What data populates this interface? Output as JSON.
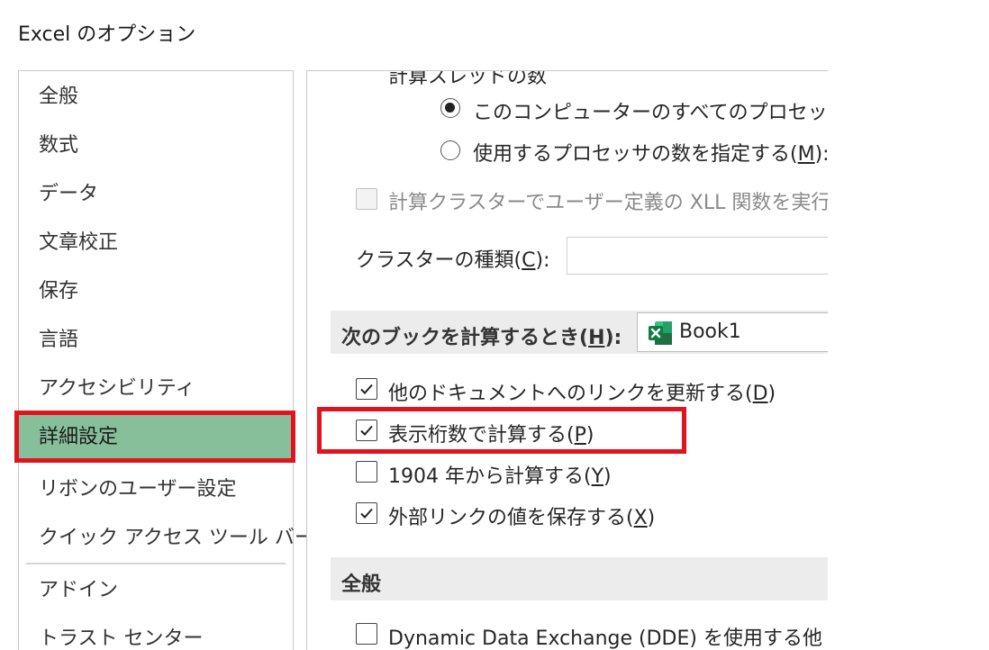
{
  "window": {
    "title": "Excel のオプション"
  },
  "sidebar": {
    "items": [
      {
        "label": "全般"
      },
      {
        "label": "数式"
      },
      {
        "label": "データ"
      },
      {
        "label": "文章校正"
      },
      {
        "label": "保存"
      },
      {
        "label": "言語"
      },
      {
        "label": "アクセシビリティ"
      },
      {
        "label": "詳細設定",
        "selected": true
      },
      {
        "label": "リボンのユーザー設定"
      },
      {
        "label": "クイック アクセス ツール バー"
      },
      {
        "label": "アドイン"
      },
      {
        "label": "トラスト センター"
      }
    ]
  },
  "formula": {
    "threads_heading_partial": "計算スレッドの数",
    "radio_all_processors": {
      "label": "このコンピューターのすべてのプロセッサを使",
      "selected": true
    },
    "radio_specify": {
      "prefix": "使用するプロセッサの数を指定する(",
      "key": "M",
      "suffix": "):",
      "selected": false
    },
    "cluster_checkbox": {
      "label": "計算クラスターでユーザー定義の XLL 関数を実行で",
      "checked": false,
      "disabled": true
    },
    "cluster_type": {
      "prefix": "クラスターの種類(",
      "key": "C",
      "suffix": "):",
      "value": ""
    }
  },
  "workbook_calc": {
    "label_prefix": "次のブックを計算するとき(",
    "label_key": "H",
    "label_suffix": "):",
    "selected_book": "Book1",
    "options": [
      {
        "prefix": "他のドキュメントへのリンクを更新する(",
        "key": "D",
        "suffix": ")",
        "checked": true
      },
      {
        "prefix": "表示桁数で計算する(",
        "key": "P",
        "suffix": ")",
        "checked": true
      },
      {
        "prefix": "1904 年から計算する(",
        "key": "Y",
        "suffix": ")",
        "checked": false
      },
      {
        "prefix": "外部リンクの値を保存する(",
        "key": "X",
        "suffix": ")",
        "checked": true
      }
    ]
  },
  "general": {
    "heading": "全般",
    "dde": {
      "label": "Dynamic Data Exchange (DDE) を使用する他",
      "checked": false
    }
  },
  "colors": {
    "selected_nav": "#87bf9b",
    "highlight": "#e0141e",
    "excel_green": "#1d7044"
  }
}
